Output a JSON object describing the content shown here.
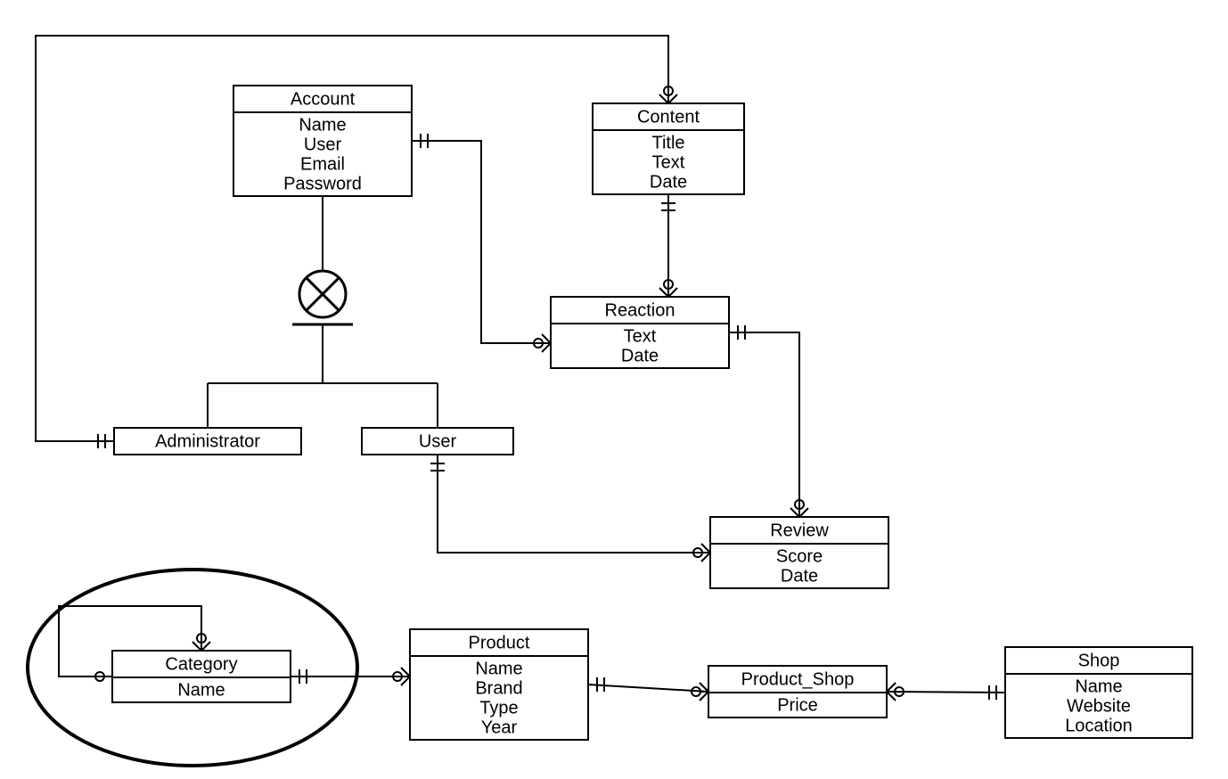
{
  "entities": {
    "account": {
      "title": "Account",
      "attrs": [
        "Name",
        "User",
        "Email",
        "Password"
      ]
    },
    "content": {
      "title": "Content",
      "attrs": [
        "Title",
        "Text",
        "Date"
      ]
    },
    "reaction": {
      "title": "Reaction",
      "attrs": [
        "Text",
        "Date"
      ]
    },
    "review": {
      "title": "Review",
      "attrs": [
        "Score",
        "Date"
      ]
    },
    "admin": {
      "title": "Administrator",
      "attrs": []
    },
    "user": {
      "title": "User",
      "attrs": []
    },
    "category": {
      "title": "Category",
      "attrs": [
        "Name"
      ]
    },
    "product": {
      "title": "Product",
      "attrs": [
        "Name",
        "Brand",
        "Type",
        "Year"
      ]
    },
    "prodshop": {
      "title": "Product_Shop",
      "attrs": [
        "Price"
      ]
    },
    "shop": {
      "title": "Shop",
      "attrs": [
        "Name",
        "Website",
        "Location"
      ]
    }
  }
}
